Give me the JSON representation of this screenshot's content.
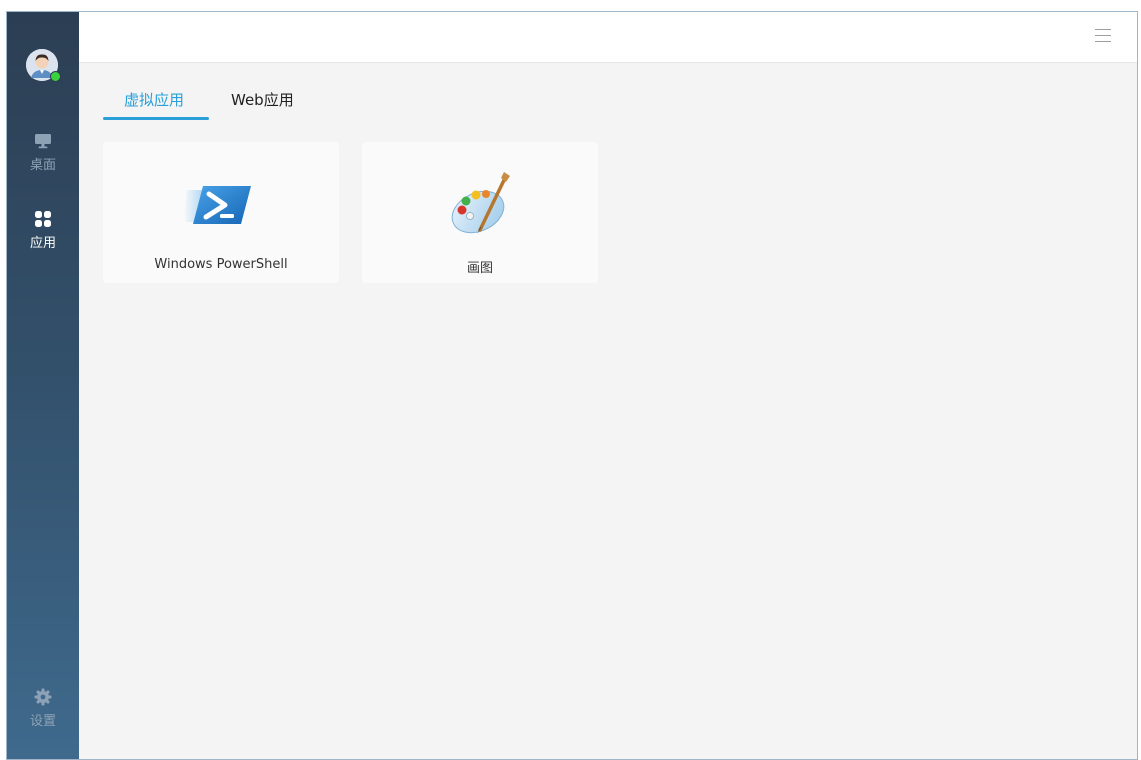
{
  "sidebar": {
    "avatar_icon": "user-avatar-icon",
    "status": "online",
    "items": [
      {
        "label": "桌面",
        "icon": "monitor-icon",
        "active": false
      },
      {
        "label": "应用",
        "icon": "grid-icon",
        "active": true
      },
      {
        "label": "设置",
        "icon": "gear-icon",
        "active": false
      }
    ]
  },
  "topbar": {
    "menu_icon": "hamburger-menu-icon"
  },
  "tabs": [
    {
      "label": "虚拟应用",
      "active": true
    },
    {
      "label": "Web应用",
      "active": false
    }
  ],
  "apps": [
    {
      "label": "Windows PowerShell",
      "icon": "powershell-icon"
    },
    {
      "label": "画图",
      "icon": "paint-palette-icon"
    }
  ],
  "colors": {
    "accent": "#2a9fd8",
    "sidebar_top": "#2c3e53",
    "sidebar_bottom": "#3f6a8d",
    "status_online": "#3bd13b",
    "content_bg": "#f4f4f4"
  }
}
